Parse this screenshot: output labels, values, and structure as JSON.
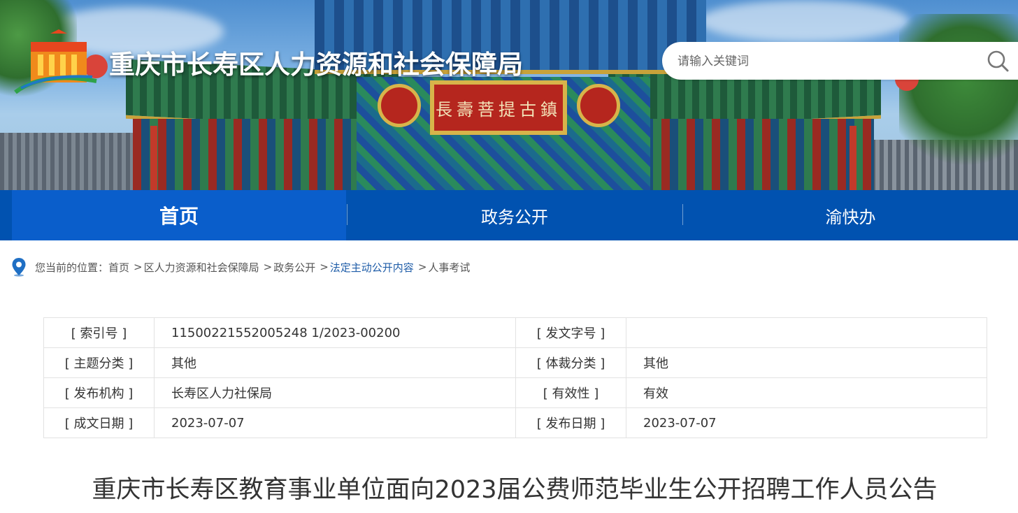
{
  "header": {
    "site_title": "重庆市长寿区人力资源和社会保障局",
    "plaque_text": "長壽菩提古鎮",
    "search": {
      "placeholder": "请输入关键词",
      "icon": "search-icon"
    }
  },
  "nav": {
    "items": [
      {
        "label": "首页",
        "active": true
      },
      {
        "label": "政务公开",
        "active": false
      },
      {
        "label": "渝快办",
        "active": false
      }
    ],
    "colors": {
      "bar": "#0152b0",
      "active": "#0a5ecb"
    }
  },
  "breadcrumb": {
    "icon": "location-pin-icon",
    "prefix": "您当前的位置：",
    "items": [
      {
        "label": "首页",
        "highlight": false
      },
      {
        "label": "区人力资源和社会保障局",
        "highlight": false
      },
      {
        "label": "政务公开",
        "highlight": false
      },
      {
        "label": "法定主动公开内容",
        "highlight": true
      },
      {
        "label": "人事考试",
        "highlight": false
      }
    ],
    "separator": ">"
  },
  "info": {
    "rows": [
      {
        "label1": "[ 索引号 ]",
        "value1": "11500221552005248 1/2023-00200",
        "label2": "[ 发文字号 ]",
        "value2": ""
      },
      {
        "label1": "[ 主题分类 ]",
        "value1": "其他",
        "label2": "[ 体裁分类 ]",
        "value2": "其他"
      },
      {
        "label1": "[ 发布机构 ]",
        "value1": "长寿区人力社保局",
        "label2": "[ 有效性 ]",
        "value2": "有效"
      },
      {
        "label1": "[ 成文日期 ]",
        "value1": "2023-07-07",
        "label2": "[ 发布日期 ]",
        "value2": "2023-07-07"
      }
    ]
  },
  "article": {
    "title": "重庆市长寿区教育事业单位面向2023届公费师范毕业生公开招聘工作人员公告"
  }
}
